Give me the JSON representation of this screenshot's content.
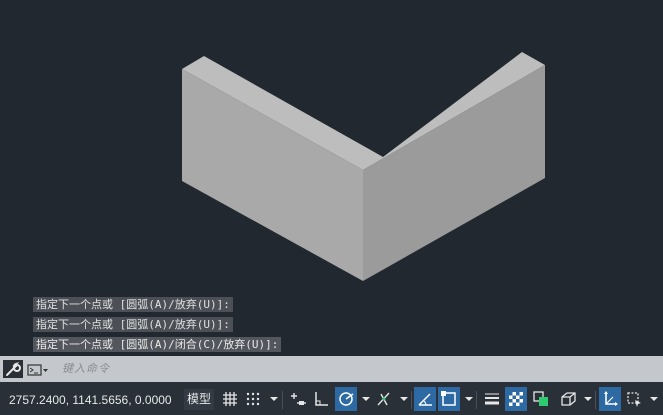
{
  "command_history": [
    "指定下一个点或 [圆弧(A)/放弃(U)]:",
    "指定下一个点或 [圆弧(A)/放弃(U)]:",
    "指定下一个点或 [圆弧(A)/闭合(C)/放弃(U)]:"
  ],
  "command_line": {
    "placeholder": "键入命令"
  },
  "status": {
    "coordinates": "2757.2400, 1141.5656, 0.0000",
    "model_label": "模型"
  },
  "colors": {
    "canvas": "#212830",
    "solid_light": "#bdbdbd",
    "solid_left": "#a9a9a9",
    "solid_right": "#9a9a9a",
    "active_toggle": "#2d6aa3",
    "green_accent": "#2ecc71"
  },
  "icons": [
    "grid-icon",
    "snap-icon",
    "infer-icon",
    "ortho-icon",
    "polar-icon",
    "isodraft-icon",
    "object-snap-tracking-icon",
    "osnap-icon",
    "lineweight-icon",
    "transparency-icon",
    "selection-cycling-icon",
    "3d-osnap-icon",
    "dynamic-ucs-icon",
    "selection-filter-icon"
  ]
}
